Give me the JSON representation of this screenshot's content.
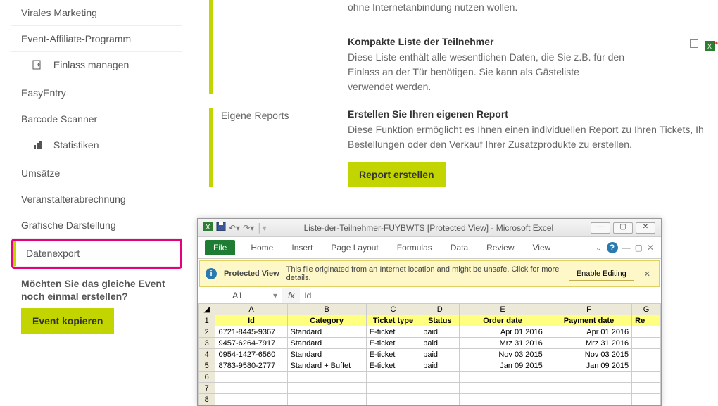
{
  "sidebar": {
    "items": [
      {
        "label": "Virales Marketing"
      },
      {
        "label": "Event-Affiliate-Programm"
      },
      {
        "label": "Einlass managen"
      },
      {
        "label": "EasyEntry"
      },
      {
        "label": "Barcode Scanner"
      },
      {
        "label": "Statistiken"
      },
      {
        "label": "Umsätze"
      },
      {
        "label": "Veranstalterabrechnung"
      },
      {
        "label": "Grafische Darstellung"
      },
      {
        "label": "Datenexport"
      }
    ],
    "promo_text": "Möchten Sie das gleiche Event noch einmal erstellen?",
    "promo_btn": "Event kopieren"
  },
  "main": {
    "list1_desc_tail": "ohne Internetanbindung nutzen wollen.",
    "kompakt": {
      "title": "Kompakte Liste der Teilnehmer",
      "desc": "Diese Liste enthält alle wesentlichen Daten, die Sie z.B. für den Einlass an der Tür benötigen. Sie kann als Gästeliste verwendet werden."
    },
    "reports": {
      "label": "Eigene Reports",
      "title": "Erstellen Sie Ihren eigenen Report",
      "desc": "Diese Funktion ermöglicht es Ihnen einen individuellen Report zu Ihren Tickets, Ih Bestellungen oder den Verkauf Ihrer Zusatzprodukte zu erstellen.",
      "btn": "Report erstellen"
    }
  },
  "excel": {
    "title": "Liste-der-Teilnehmer-FUYBWTS  [Protected View]  -  Microsoft Excel",
    "ribbon": [
      "File",
      "Home",
      "Insert",
      "Page Layout",
      "Formulas",
      "Data",
      "Review",
      "View"
    ],
    "pv_label": "Protected View",
    "pv_msg": "This file originated from an Internet location and might be unsafe. Click for more details.",
    "pv_btn": "Enable Editing",
    "namebox": "A1",
    "fx": "Id",
    "col_letters": [
      "A",
      "B",
      "C",
      "D",
      "E",
      "F",
      "G"
    ],
    "headers": [
      "Id",
      "Category",
      "Ticket type",
      "Status",
      "Order date",
      "Payment date",
      "Re"
    ],
    "rows": [
      [
        "6721-8445-9367",
        "Standard",
        "E-ticket",
        "paid",
        "Apr 01 2016",
        "Apr 01 2016",
        ""
      ],
      [
        "9457-6264-7917",
        "Standard",
        "E-ticket",
        "paid",
        "Mrz 31 2016",
        "Mrz 31 2016",
        ""
      ],
      [
        "0954-1427-6560",
        "Standard",
        "E-ticket",
        "paid",
        "Nov 03 2015",
        "Nov 03 2015",
        ""
      ],
      [
        "8783-9580-2777",
        "Standard + Buffet",
        "E-ticket",
        "paid",
        "Jan 09 2015",
        "Jan 09 2015",
        ""
      ]
    ]
  }
}
